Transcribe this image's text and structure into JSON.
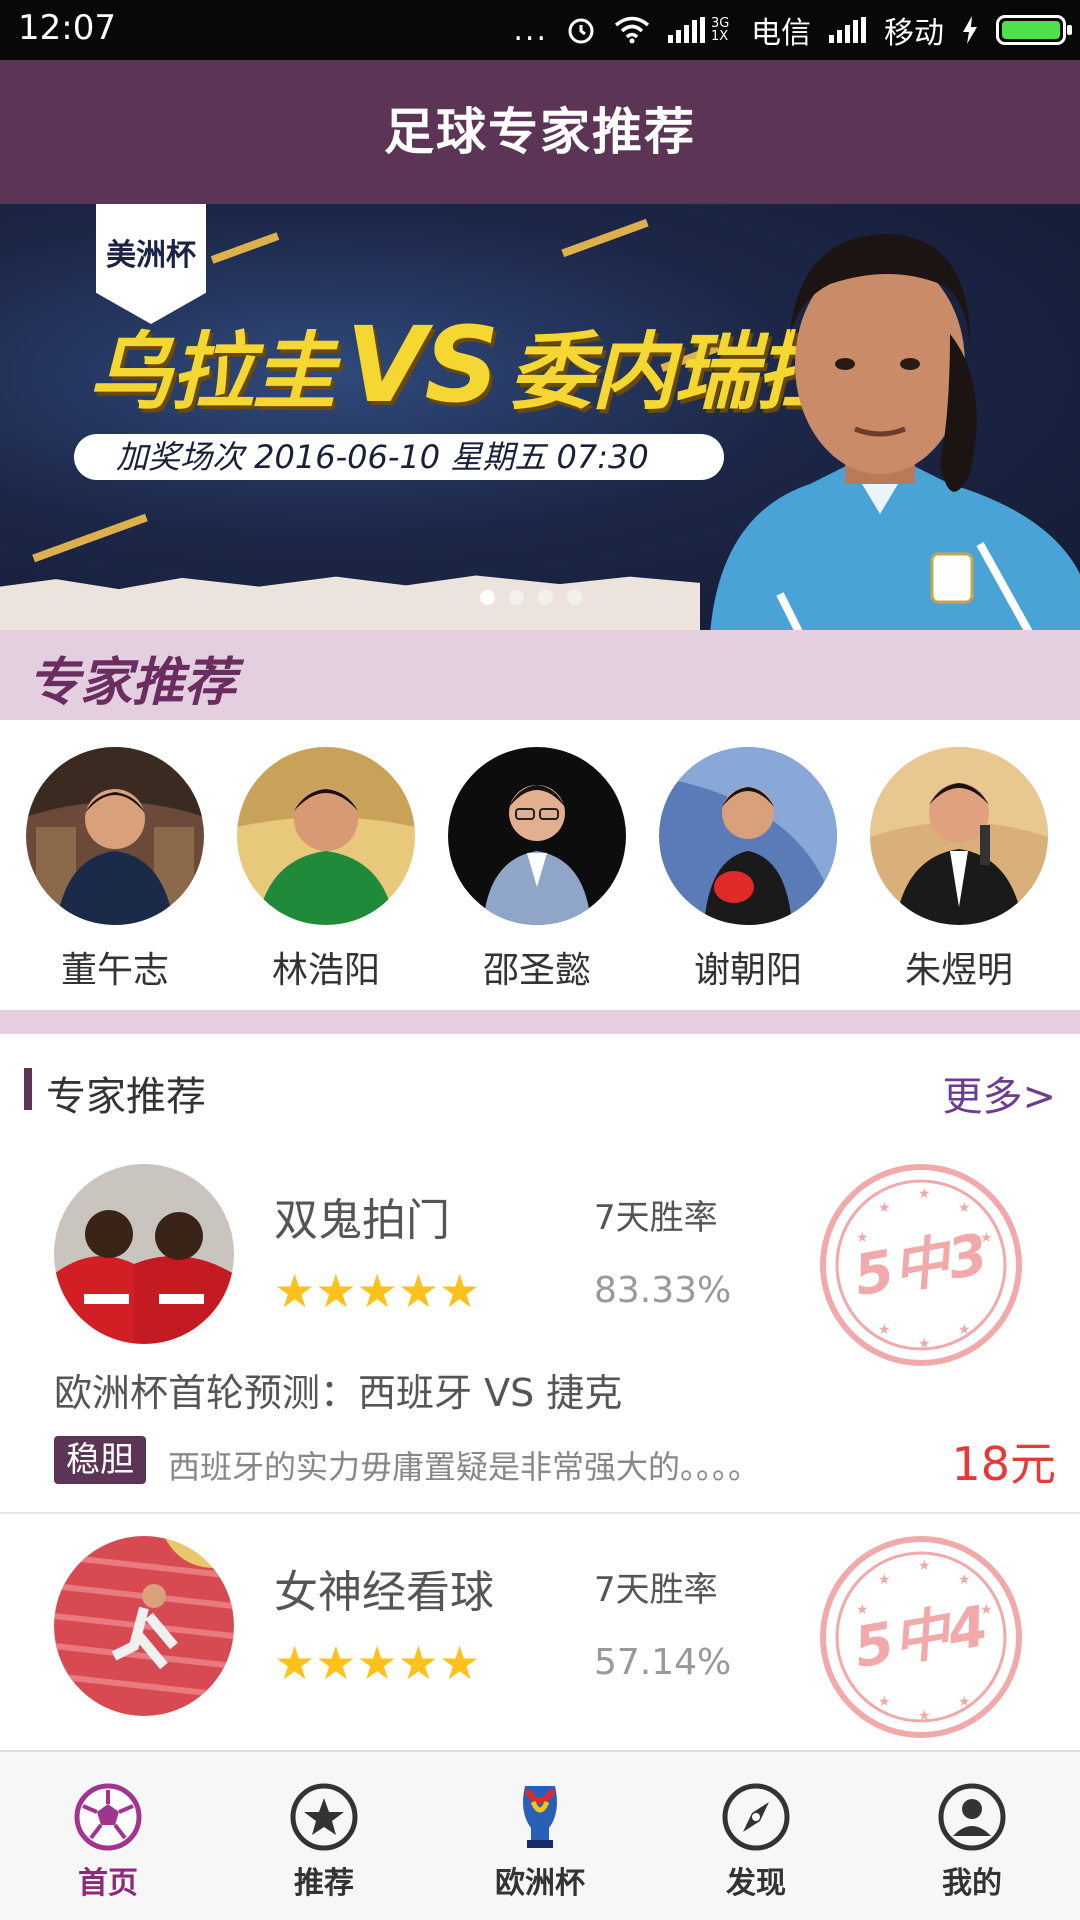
{
  "status_bar": {
    "time": "12:07",
    "dots": "...",
    "network_type": "3G\n1X",
    "carrier1": "电信",
    "carrier2": "移动"
  },
  "header": {
    "title": "足球专家推荐"
  },
  "banner": {
    "tag": "美洲杯",
    "team1": "乌拉圭",
    "vs": "VS",
    "team2": "委内瑞拉",
    "date_line": "加奖场次  2016-06-10 星期五 07:30",
    "pager_count": 4,
    "pager_active": 0
  },
  "expert_section_banner": {
    "label": "专家推荐"
  },
  "experts": [
    {
      "name": "董午志"
    },
    {
      "name": "林浩阳"
    },
    {
      "name": "邵圣懿"
    },
    {
      "name": "谢朝阳"
    },
    {
      "name": "朱煜明"
    }
  ],
  "recommend": {
    "section_title": "专家推荐",
    "more_label": "更多>",
    "items": [
      {
        "name": "双鬼拍门",
        "stars": "★★★★★",
        "rating": 5,
        "win_rate_label": "7天胜率",
        "win_rate": "83.33%",
        "stamp": "5中3",
        "title": "欧洲杯首轮预测：西班牙 VS 捷克",
        "badge": "稳胆",
        "desc": "西班牙的实力毋庸置疑是非常强大的。。。。",
        "price": "18元"
      },
      {
        "name": "女神经看球",
        "stars": "★★★★★",
        "rating": 5,
        "win_rate_label": "7天胜率",
        "win_rate": "57.14%",
        "stamp": "5中4"
      }
    ]
  },
  "bottom_nav": [
    {
      "label": "首页",
      "icon": "soccer-ball-icon",
      "active": true
    },
    {
      "label": "推荐",
      "icon": "star-icon",
      "active": false
    },
    {
      "label": "欧洲杯",
      "icon": "euro-cup-icon",
      "active": false
    },
    {
      "label": "发现",
      "icon": "compass-icon",
      "active": false
    },
    {
      "label": "我的",
      "icon": "user-icon",
      "active": false
    }
  ],
  "colors": {
    "header_bg": "#5b3456",
    "section_bg": "#e3cfe0",
    "accent_purple": "#8b2a7a",
    "star_yellow": "#fcc11a",
    "price_red": "#e63a3a"
  }
}
